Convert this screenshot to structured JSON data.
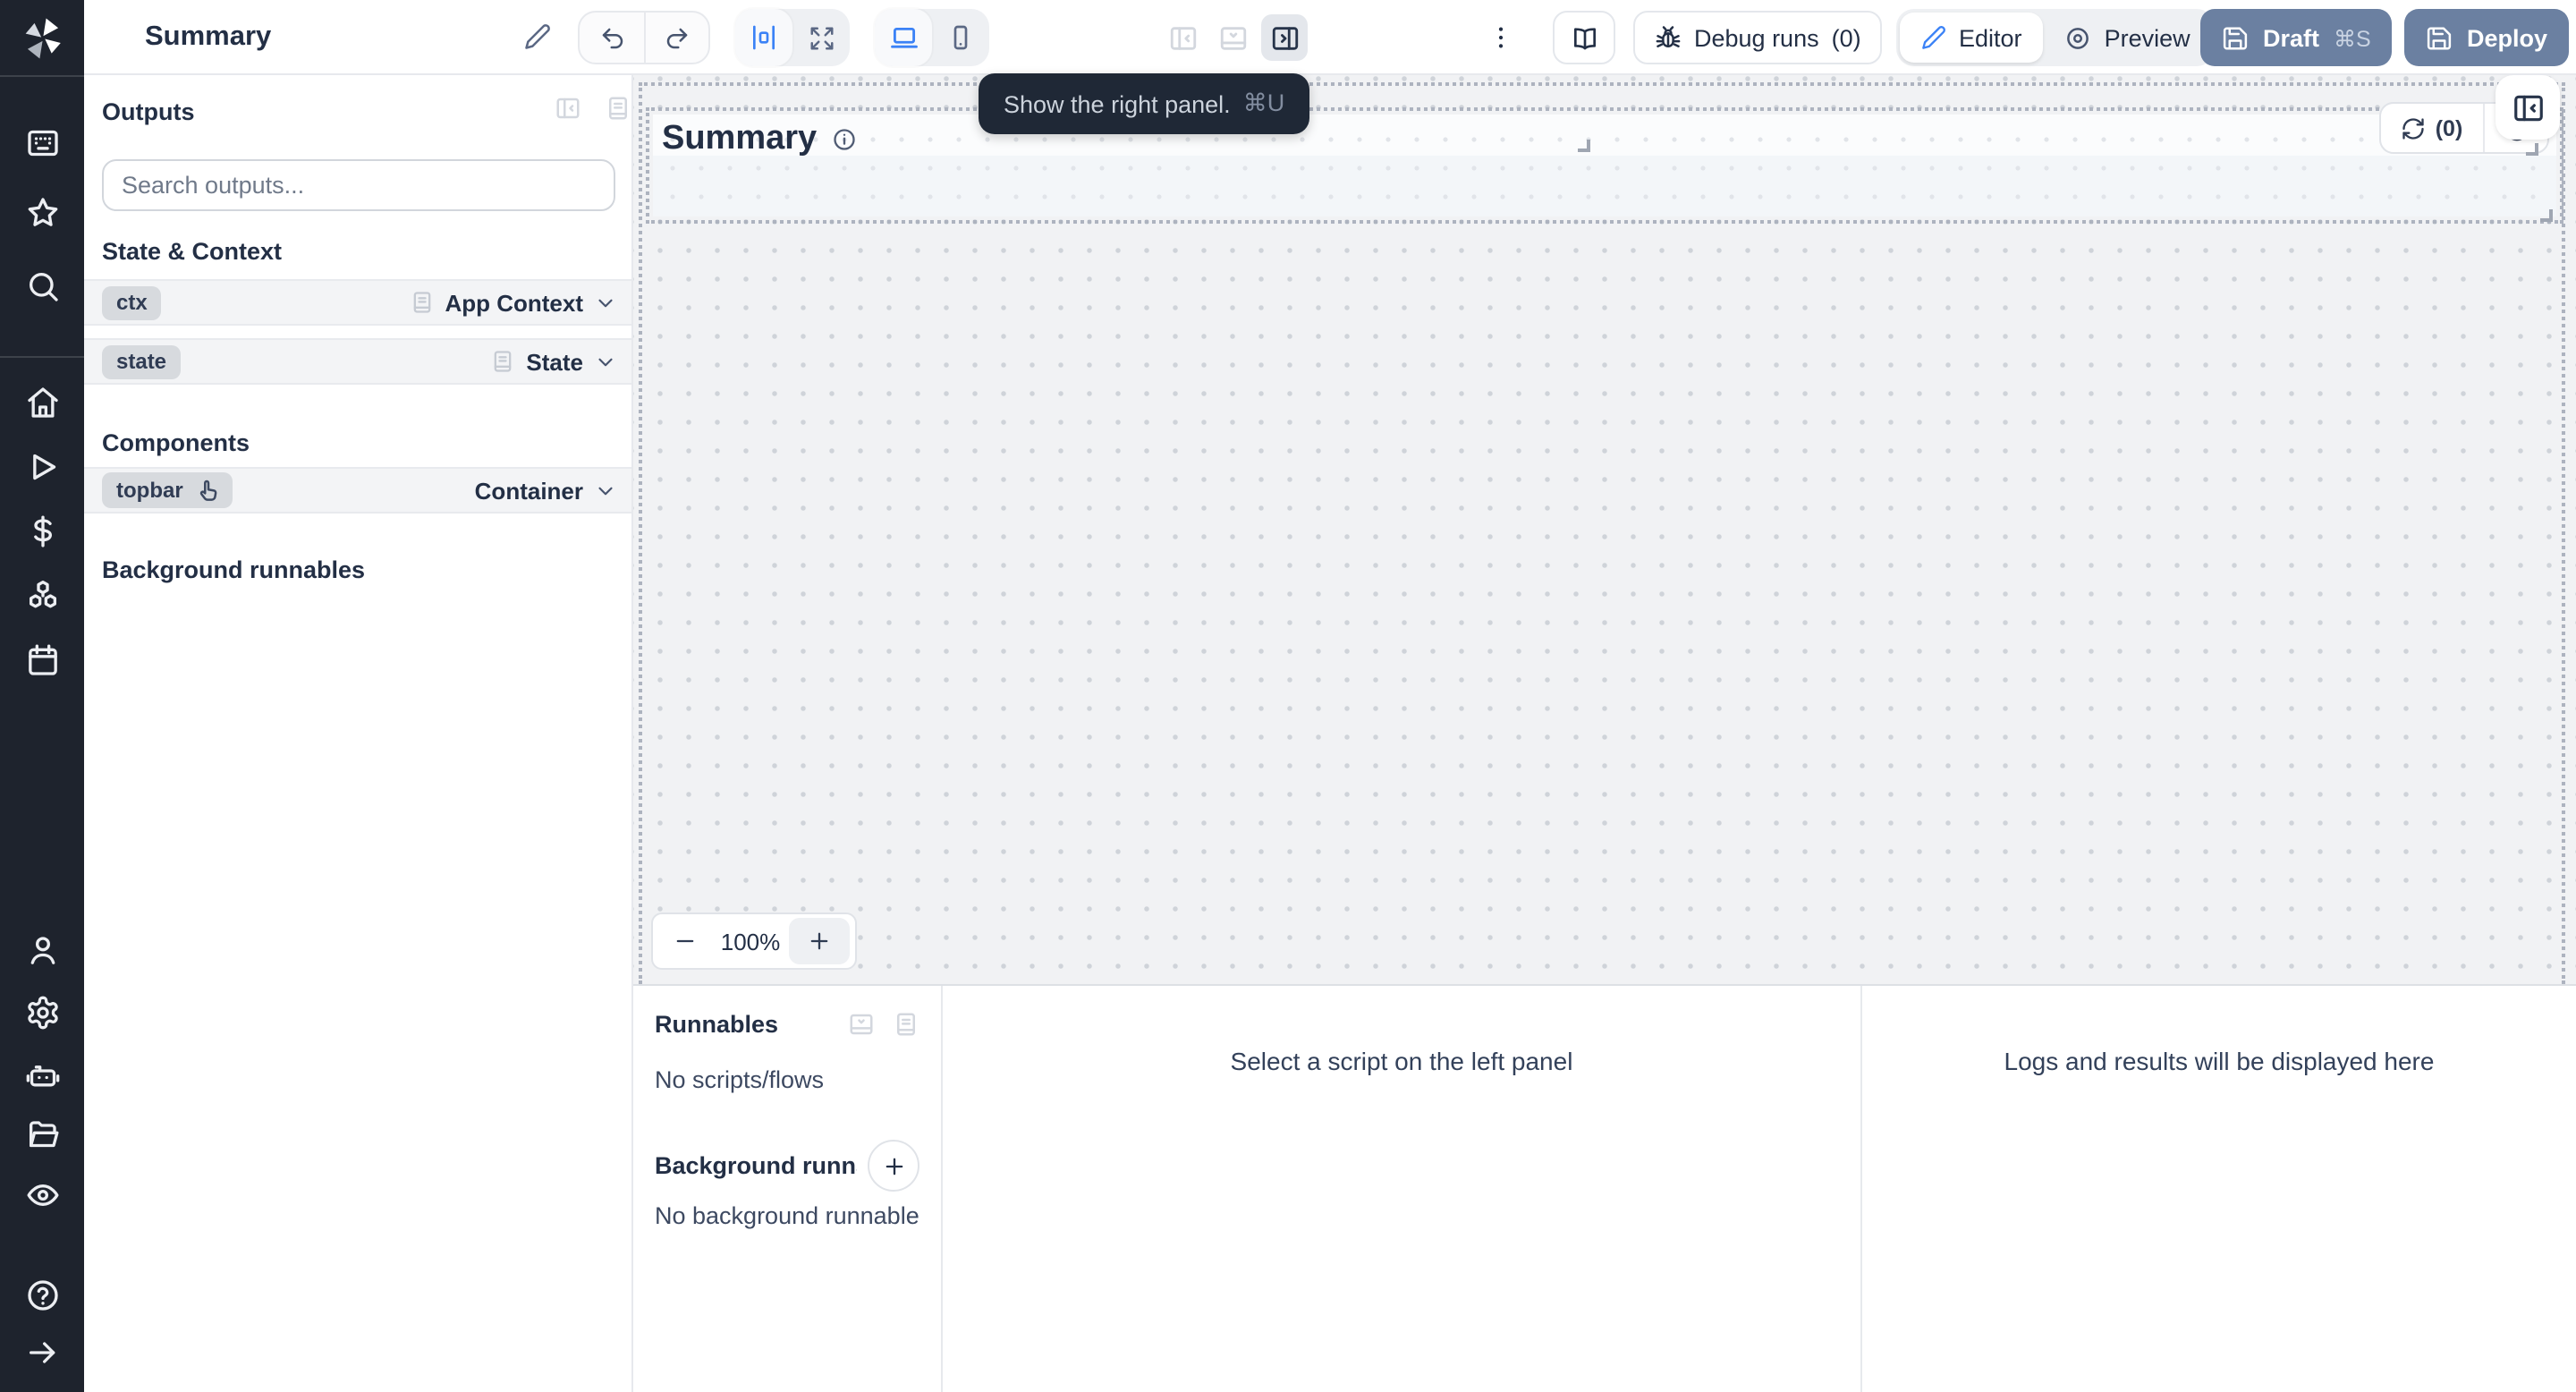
{
  "topbar": {
    "title": "Summary",
    "debug_runs_label": "Debug runs",
    "debug_runs_count": "(0)",
    "editor_label": "Editor",
    "preview_label": "Preview",
    "draft_label": "Draft",
    "draft_shortcut": "⌘S",
    "deploy_label": "Deploy"
  },
  "tooltip": {
    "text": "Show the right panel.",
    "shortcut": "⌘U"
  },
  "left_panel": {
    "outputs_title": "Outputs",
    "search_placeholder": "Search outputs...",
    "section_state_context": "State & Context",
    "section_components": "Components",
    "section_background_runnables": "Background runnables",
    "rows": [
      {
        "id": "ctx",
        "type": "App Context"
      },
      {
        "id": "state",
        "type": "State"
      },
      {
        "id": "topbar",
        "type": "Container"
      }
    ]
  },
  "canvas": {
    "heading": "Summary",
    "refresh_count": "(0)",
    "zoom_level": "100%"
  },
  "bottom_panel": {
    "runnables_title": "Runnables",
    "no_scripts": "No scripts/flows",
    "background_title": "Background runna...",
    "no_background": "No background runnable",
    "select_script_hint": "Select a script on the left panel",
    "logs_hint": "Logs and results will be displayed here"
  },
  "sidebar": {
    "icons_top": [
      "apps",
      "favorites",
      "search"
    ],
    "icons_main": [
      "home",
      "runs",
      "variables",
      "resources",
      "schedules"
    ],
    "icons_account": [
      "user",
      "settings",
      "ai",
      "folders",
      "audit"
    ],
    "icons_footer": [
      "help",
      "expand"
    ]
  },
  "colors": {
    "accent_blue": "#3b82f6",
    "sidebar_bg": "#1e232d",
    "primary_button": "#6b80a1",
    "tooltip_bg": "#1f2836",
    "canvas_bg": "#f1f2f4"
  }
}
